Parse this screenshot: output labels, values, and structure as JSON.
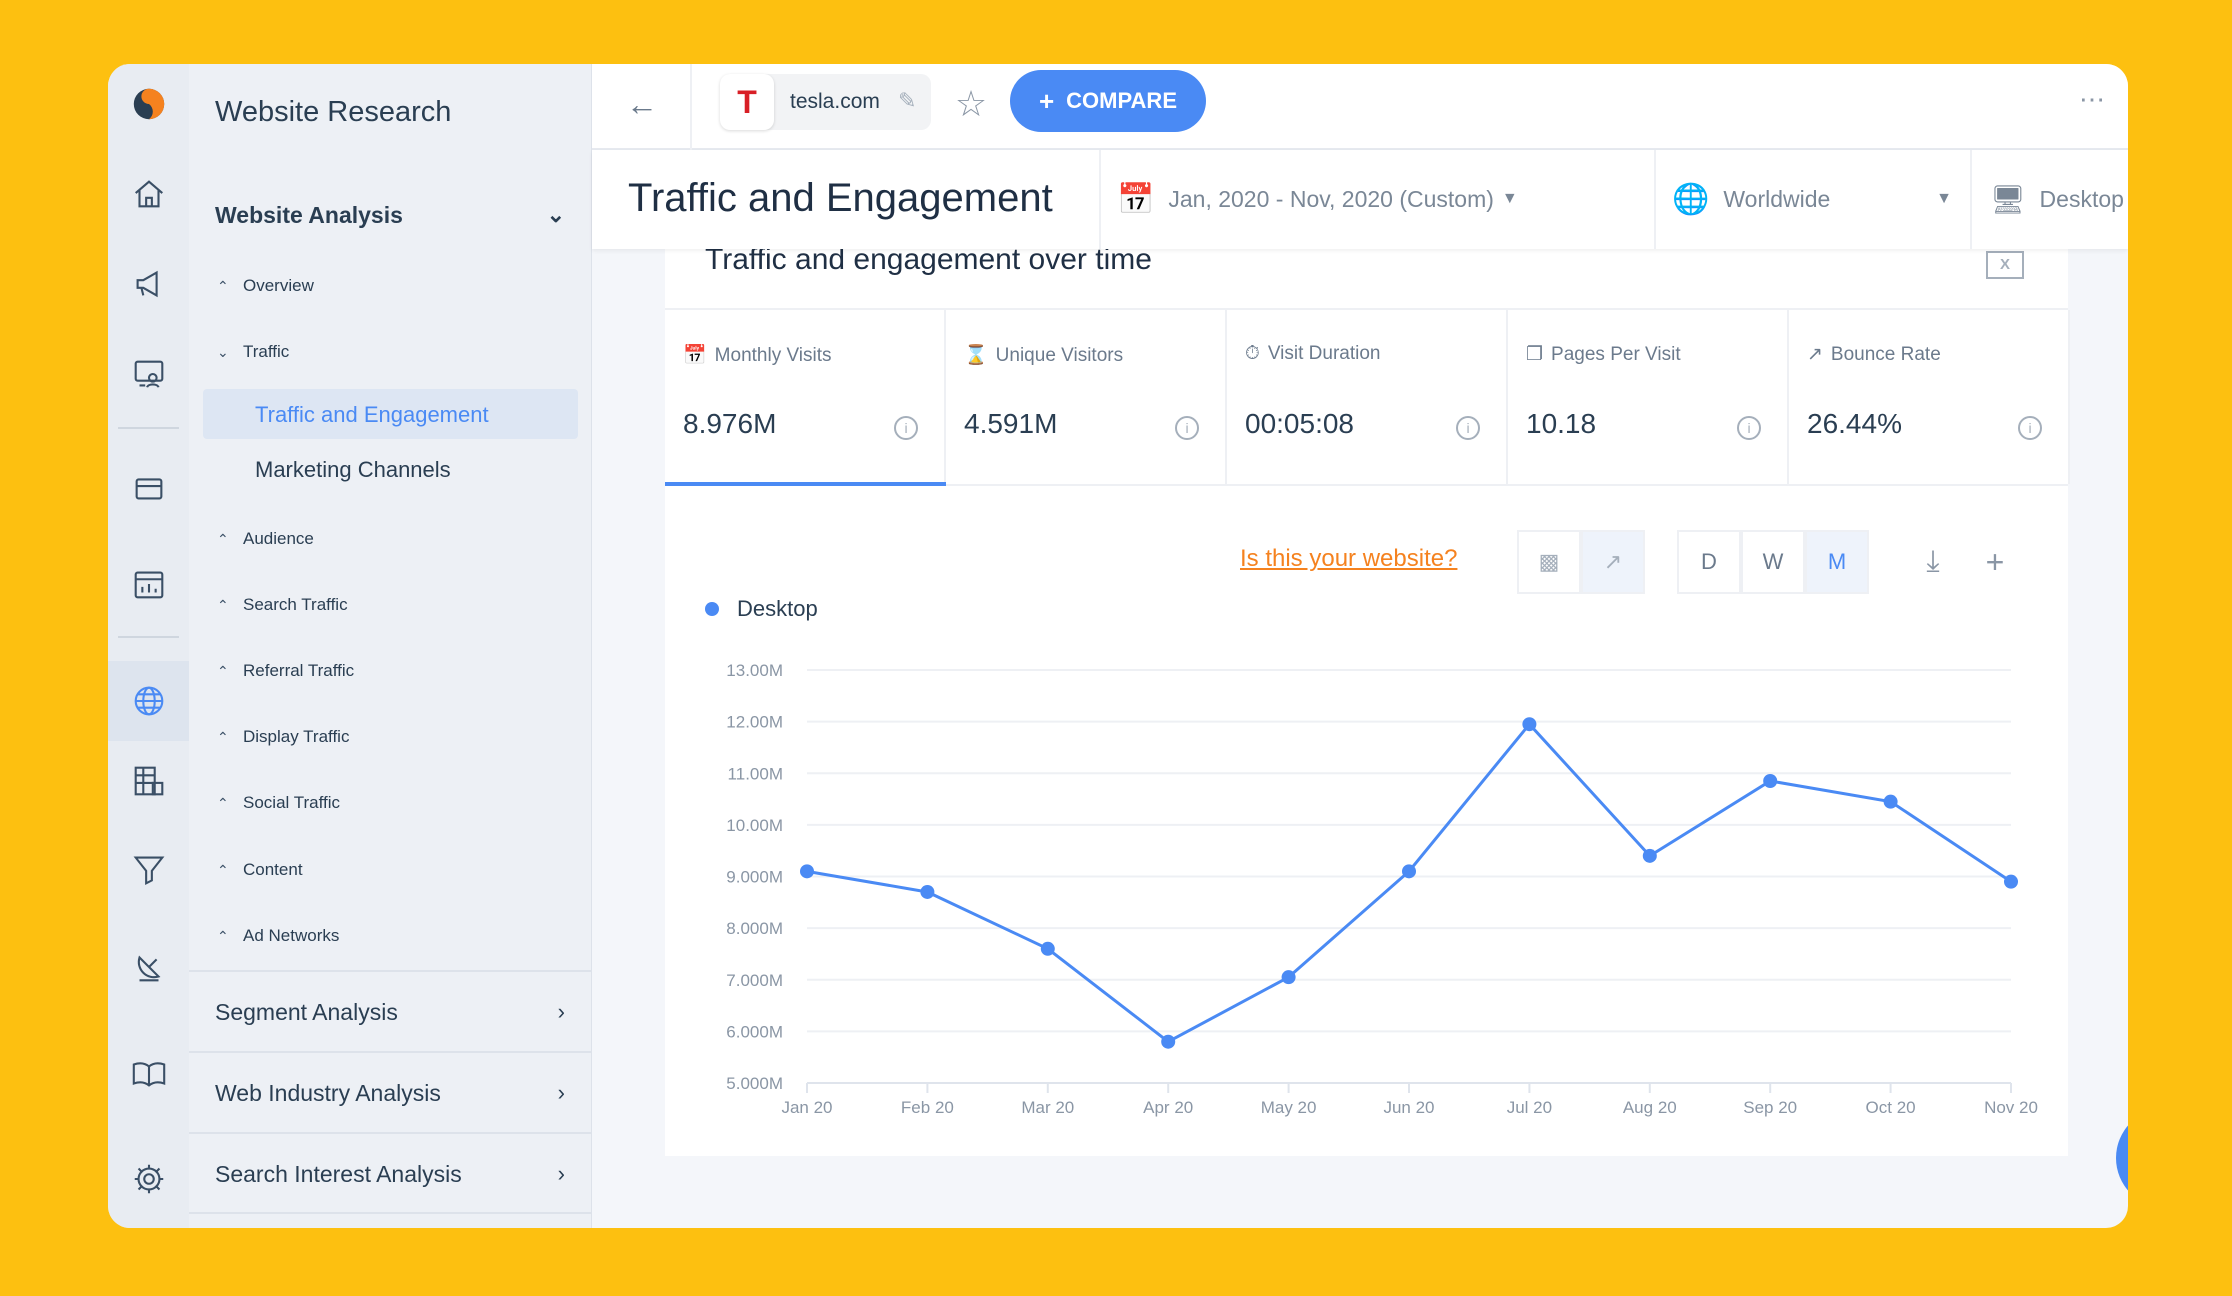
{
  "sidebar": {
    "title": "Website Research",
    "website_analysis": "Website Analysis",
    "items": [
      "Overview",
      "Traffic",
      "Audience",
      "Search Traffic",
      "Referral Traffic",
      "Display Traffic",
      "Social Traffic",
      "Content",
      "Ad Networks"
    ],
    "traffic_children": [
      "Traffic and Engagement",
      "Marketing Channels"
    ],
    "sections": [
      "Segment Analysis",
      "Web Industry Analysis",
      "Search Interest Analysis"
    ]
  },
  "topbar": {
    "domain": "tesla.com",
    "compare": "COMPARE"
  },
  "header": {
    "title": "Traffic and Engagement",
    "date_range": "Jan, 2020 - Nov, 2020 (Custom)",
    "region": "Worldwide",
    "device": "Desktop"
  },
  "panel": {
    "title": "Traffic and engagement over time",
    "is_your_website": "Is this your website?",
    "granularity": [
      "D",
      "W",
      "M"
    ],
    "selected_granularity": "M"
  },
  "metrics": [
    {
      "label": "Monthly Visits",
      "value": "8.976M"
    },
    {
      "label": "Unique Visitors",
      "value": "4.591M"
    },
    {
      "label": "Visit Duration",
      "value": "00:05:08"
    },
    {
      "label": "Pages Per Visit",
      "value": "10.18"
    },
    {
      "label": "Bounce Rate",
      "value": "26.44%"
    }
  ],
  "colors": {
    "accent": "#4A8AF4",
    "background": "#FDC010",
    "link": "#F5821F"
  },
  "chart_data": {
    "type": "line",
    "categories": [
      "Jan 20",
      "Feb 20",
      "Mar 20",
      "Apr 20",
      "May 20",
      "Jun 20",
      "Jul 20",
      "Aug 20",
      "Sep 20",
      "Oct 20",
      "Nov 20"
    ],
    "series": [
      {
        "name": "Desktop",
        "values": [
          9.1,
          8.7,
          7.6,
          5.8,
          7.05,
          9.1,
          11.95,
          9.4,
          10.85,
          10.45,
          8.9
        ]
      }
    ],
    "yticks": [
      "5.000M",
      "6.000M",
      "7.000M",
      "8.000M",
      "9.000M",
      "10.00M",
      "11.00M",
      "12.00M",
      "13.00M"
    ],
    "ylim": [
      5,
      13
    ],
    "unit": "M",
    "grid": true,
    "legend": "top-left"
  }
}
